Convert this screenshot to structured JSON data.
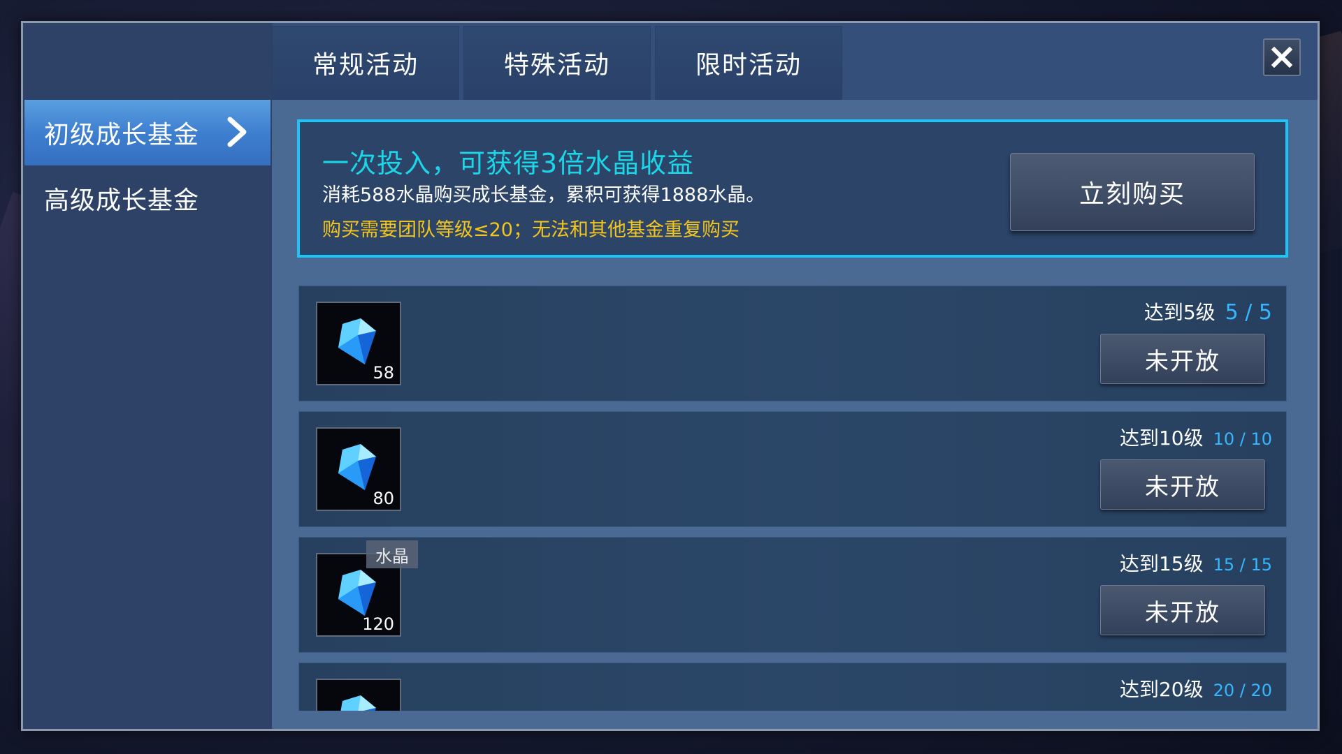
{
  "tabs": [
    {
      "label": "常规活动"
    },
    {
      "label": "特殊活动"
    },
    {
      "label": "限时活动"
    }
  ],
  "close_label": "X",
  "sidebar": {
    "items": [
      {
        "label": "初级成长基金",
        "active": true
      },
      {
        "label": "高级成长基金",
        "active": false
      }
    ]
  },
  "banner": {
    "title": "一次投入，可获得3倍水晶收益",
    "description": "消耗588水晶购买成长基金，累积可获得1888水晶。",
    "note": "购买需要团队等级≤20；无法和其他基金重复购买",
    "buy_label": "立刻购买"
  },
  "rewards": [
    {
      "quantity": "58",
      "requirement": "达到5级",
      "progress": "5 / 5",
      "status": "未开放"
    },
    {
      "quantity": "80",
      "requirement": "达到10级",
      "progress": "10 / 10",
      "status": "未开放"
    },
    {
      "quantity": "120",
      "requirement": "达到15级",
      "progress": "15 / 15",
      "status": "未开放",
      "tooltip": "水晶"
    },
    {
      "quantity": "",
      "requirement": "达到20级",
      "progress": "20 / 20",
      "status": ""
    }
  ],
  "colors": {
    "title_cyan": "#1cd6e8",
    "note_yellow": "#f4c51a",
    "progress_blue": "#35b8ff",
    "banner_border": "#1ec4f5"
  },
  "icons": {
    "reward": "crystal-icon",
    "close": "close-icon",
    "active_arrow": "chevron-right-icon"
  }
}
